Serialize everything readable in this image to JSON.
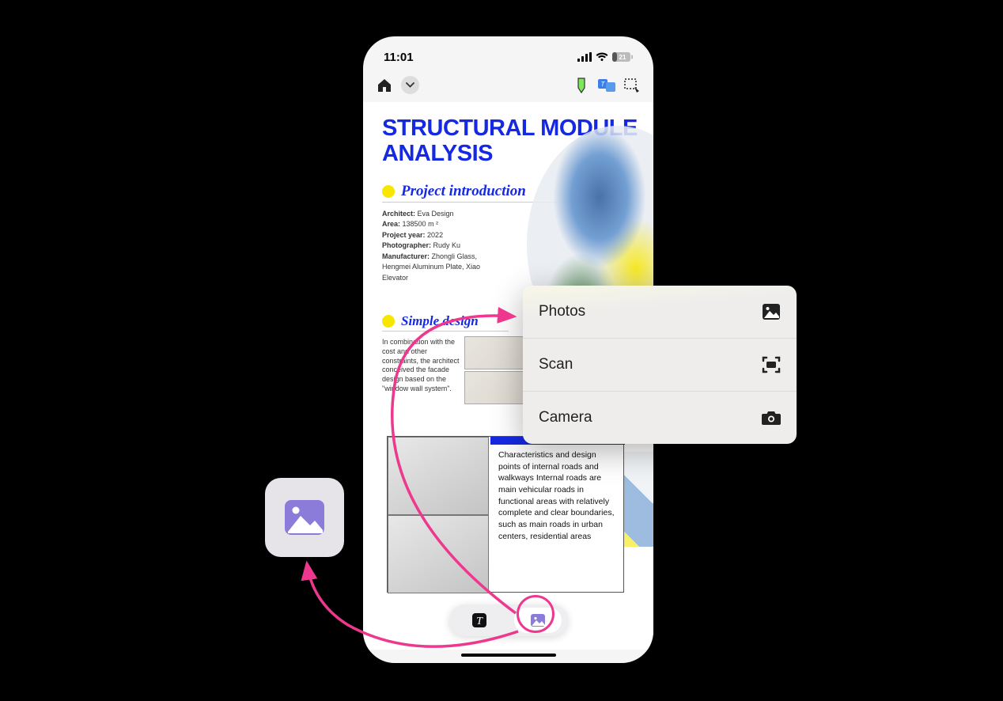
{
  "status": {
    "time": "11:01",
    "battery": "21"
  },
  "toolbar": {
    "home": "home-icon",
    "chevron": "chevron-down-icon",
    "marker": "marker-icon",
    "translate": "translate-icon",
    "lasso": "lasso-icon"
  },
  "doc": {
    "title": "STRUCTURAL MODULE ANALYSIS",
    "section1": {
      "title": "Project introduction",
      "meta": {
        "architect_label": "Architect:",
        "architect": "Eva Design",
        "area_label": "Area:",
        "area": "138500 m ²",
        "year_label": "Project year:",
        "year": "2022",
        "photographer_label": "Photographer:",
        "photographer": "Rudy Ku",
        "manufacturer_label": "Manufacturer:",
        "manufacturer": "Zhongli Glass, Hengmei Aluminum Plate, Xiao Elevator"
      }
    },
    "section2": {
      "title": "Simple design",
      "body": "In combination with the cost and other constraints, the architect conceived the facade design based on the \"window wall system\"."
    },
    "lower": {
      "body": "Characteristics and design points of internal roads and walkways Internal roads are main vehicular roads in functional areas with relatively complete and clear boundaries, such as main roads in urban centers, residential areas"
    }
  },
  "bottompill": {
    "text_btn": "text-tool",
    "image_btn": "image-tool"
  },
  "popup": {
    "items": [
      {
        "label": "Photos",
        "icon": "photo-icon"
      },
      {
        "label": "Scan",
        "icon": "scan-icon"
      },
      {
        "label": "Camera",
        "icon": "camera-icon"
      }
    ]
  },
  "colors": {
    "accent_blue": "#1529e3",
    "yellow": "#f7e600",
    "pink": "#ed388e",
    "purple": "#8b7cd9"
  }
}
